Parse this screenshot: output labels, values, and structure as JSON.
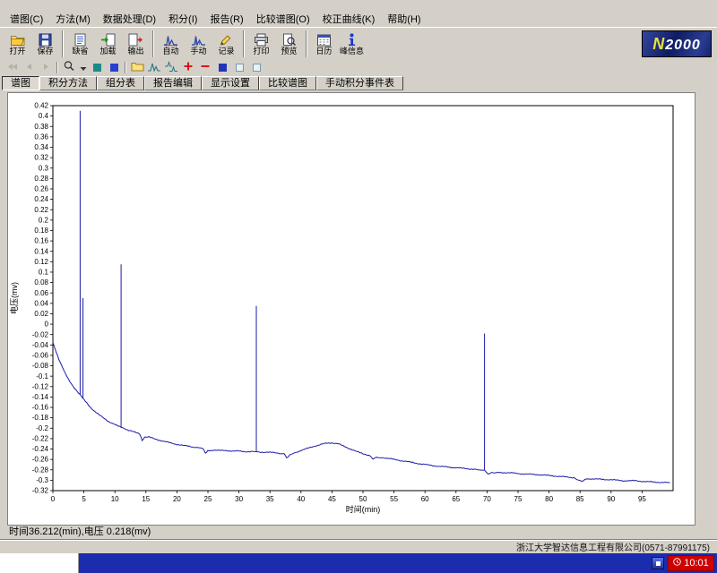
{
  "menubar": {
    "items": [
      "谱图(C)",
      "方法(M)",
      "数据处理(D)",
      "积分(I)",
      "报告(R)",
      "比较谱图(O)",
      "校正曲线(K)",
      "帮助(H)"
    ]
  },
  "toolbar": {
    "buttons": [
      {
        "label": "打开",
        "icon": "open-folder-icon"
      },
      {
        "label": "保存",
        "icon": "save-floppy-icon"
      },
      {
        "label": "缺省",
        "icon": "default-document-icon"
      },
      {
        "label": "加载",
        "icon": "load-arrow-icon"
      },
      {
        "label": "输出",
        "icon": "export-arrow-icon"
      },
      {
        "label": "自动",
        "icon": "auto-peaks-icon"
      },
      {
        "label": "手动",
        "icon": "manual-peaks-icon"
      },
      {
        "label": "记录",
        "icon": "record-pencil-icon"
      },
      {
        "label": "打印",
        "icon": "printer-icon"
      },
      {
        "label": "预览",
        "icon": "preview-magnifier-icon"
      },
      {
        "label": "日历",
        "icon": "calendar-icon"
      },
      {
        "label": "峰信息",
        "icon": "peak-info-icon"
      }
    ],
    "logo": "N2000"
  },
  "toolbar2": {
    "icons": [
      "nav-first-icon",
      "nav-prev-icon",
      "nav-next-icon",
      "zoom-magnifier-icon",
      "zoom-dropdown-icon",
      "full-view-icon",
      "fit-view-icon",
      "open-compare-icon",
      "overlay-curves-icon",
      "stack-curves-icon",
      "add-curve-icon",
      "remove-curve-icon",
      "color-swatch-icon",
      "frame-icon",
      "frame-icon"
    ]
  },
  "tabs": {
    "items": [
      "谱图",
      "积分方法",
      "组分表",
      "报告编辑",
      "显示设置",
      "比较谱图",
      "手动积分事件表"
    ]
  },
  "chart_data": {
    "type": "line",
    "title": "",
    "xlabel": "时间(min)",
    "ylabel": "电压(mv)",
    "xlim": [
      0,
      100
    ],
    "ylim": [
      -0.32,
      0.42
    ],
    "xtick_step": 5,
    "ytick_step": 0.02,
    "grid": false,
    "legend": "none",
    "line_color": "#1a1aa6",
    "baseline": [
      [
        0,
        -0.035
      ],
      [
        0.5,
        -0.052
      ],
      [
        1,
        -0.068
      ],
      [
        1.5,
        -0.082
      ],
      [
        2,
        -0.095
      ],
      [
        2.5,
        -0.106
      ],
      [
        3,
        -0.115
      ],
      [
        3.5,
        -0.123
      ],
      [
        4,
        -0.13
      ],
      [
        4.4,
        -0.136
      ],
      [
        5,
        -0.145
      ],
      [
        5.5,
        -0.152
      ],
      [
        6,
        -0.159
      ],
      [
        6.5,
        -0.165
      ],
      [
        7,
        -0.17
      ],
      [
        7.5,
        -0.175
      ],
      [
        8,
        -0.179
      ],
      [
        8.5,
        -0.183
      ],
      [
        9,
        -0.187
      ],
      [
        9.5,
        -0.19
      ],
      [
        10,
        -0.193
      ],
      [
        10.5,
        -0.196
      ],
      [
        11,
        -0.198
      ],
      [
        11.5,
        -0.2
      ],
      [
        12,
        -0.203
      ],
      [
        13,
        -0.207
      ],
      [
        14,
        -0.211
      ],
      [
        14.4,
        -0.224
      ],
      [
        14.8,
        -0.217
      ],
      [
        15.5,
        -0.217
      ],
      [
        16.5,
        -0.221
      ],
      [
        17.5,
        -0.224
      ],
      [
        18.5,
        -0.227
      ],
      [
        19.5,
        -0.23
      ],
      [
        20.5,
        -0.232
      ],
      [
        21.5,
        -0.234
      ],
      [
        22.5,
        -0.236
      ],
      [
        23.5,
        -0.237
      ],
      [
        24.2,
        -0.239
      ],
      [
        24.6,
        -0.248
      ],
      [
        25,
        -0.243
      ],
      [
        26,
        -0.242
      ],
      [
        27,
        -0.243
      ],
      [
        28,
        -0.243
      ],
      [
        29,
        -0.244
      ],
      [
        30,
        -0.244
      ],
      [
        31,
        -0.245
      ],
      [
        32,
        -0.245
      ],
      [
        32.8,
        -0.245
      ],
      [
        33.5,
        -0.246
      ],
      [
        34.5,
        -0.246
      ],
      [
        35.5,
        -0.247
      ],
      [
        36.5,
        -0.248
      ],
      [
        37.3,
        -0.249
      ],
      [
        37.7,
        -0.257
      ],
      [
        38.2,
        -0.251
      ],
      [
        39,
        -0.247
      ],
      [
        40,
        -0.243
      ],
      [
        41,
        -0.239
      ],
      [
        42,
        -0.235
      ],
      [
        43,
        -0.232
      ],
      [
        44,
        -0.229
      ],
      [
        45,
        -0.228
      ],
      [
        46,
        -0.23
      ],
      [
        47,
        -0.235
      ],
      [
        48,
        -0.24
      ],
      [
        49,
        -0.245
      ],
      [
        50,
        -0.249
      ],
      [
        51,
        -0.252
      ],
      [
        51.6,
        -0.259
      ],
      [
        52.2,
        -0.255
      ],
      [
        53,
        -0.256
      ],
      [
        54,
        -0.258
      ],
      [
        55,
        -0.26
      ],
      [
        56,
        -0.262
      ],
      [
        57,
        -0.264
      ],
      [
        58,
        -0.266
      ],
      [
        59,
        -0.268
      ],
      [
        60,
        -0.27
      ],
      [
        62,
        -0.273
      ],
      [
        64,
        -0.275
      ],
      [
        66,
        -0.277
      ],
      [
        68,
        -0.279
      ],
      [
        69.6,
        -0.281
      ],
      [
        70.2,
        -0.289
      ],
      [
        70.8,
        -0.285
      ],
      [
        72,
        -0.285
      ],
      [
        74,
        -0.286
      ],
      [
        76,
        -0.288
      ],
      [
        78,
        -0.289
      ],
      [
        80,
        -0.291
      ],
      [
        82,
        -0.293
      ],
      [
        84,
        -0.295
      ],
      [
        85.3,
        -0.302
      ],
      [
        86,
        -0.297
      ],
      [
        88,
        -0.298
      ],
      [
        90,
        -0.299
      ],
      [
        92,
        -0.301
      ],
      [
        94,
        -0.301
      ],
      [
        96,
        -0.303
      ],
      [
        98,
        -0.304
      ],
      [
        99.5,
        -0.305
      ]
    ],
    "spikes": [
      {
        "x": 4.4,
        "y_top": 0.41
      },
      {
        "x": 4.85,
        "y_top": 0.05
      },
      {
        "x": 11.0,
        "y_top": 0.115
      },
      {
        "x": 32.8,
        "y_top": 0.035
      },
      {
        "x": 69.6,
        "y_top": -0.018
      }
    ]
  },
  "statusbar": {
    "readout": "时间36.212(min),电压 0.218(mv)"
  },
  "footer": {
    "company": "浙江大学智达信息工程有限公司(0571-87991175)"
  },
  "taskbar": {
    "clock": "10:01"
  },
  "colors": {
    "chrome": "#d4d0c8",
    "trace": "#1a1aa6",
    "taskbar": "#1c2cae",
    "clock_bg": "#cf0000",
    "logo_bg": "#101c62"
  }
}
